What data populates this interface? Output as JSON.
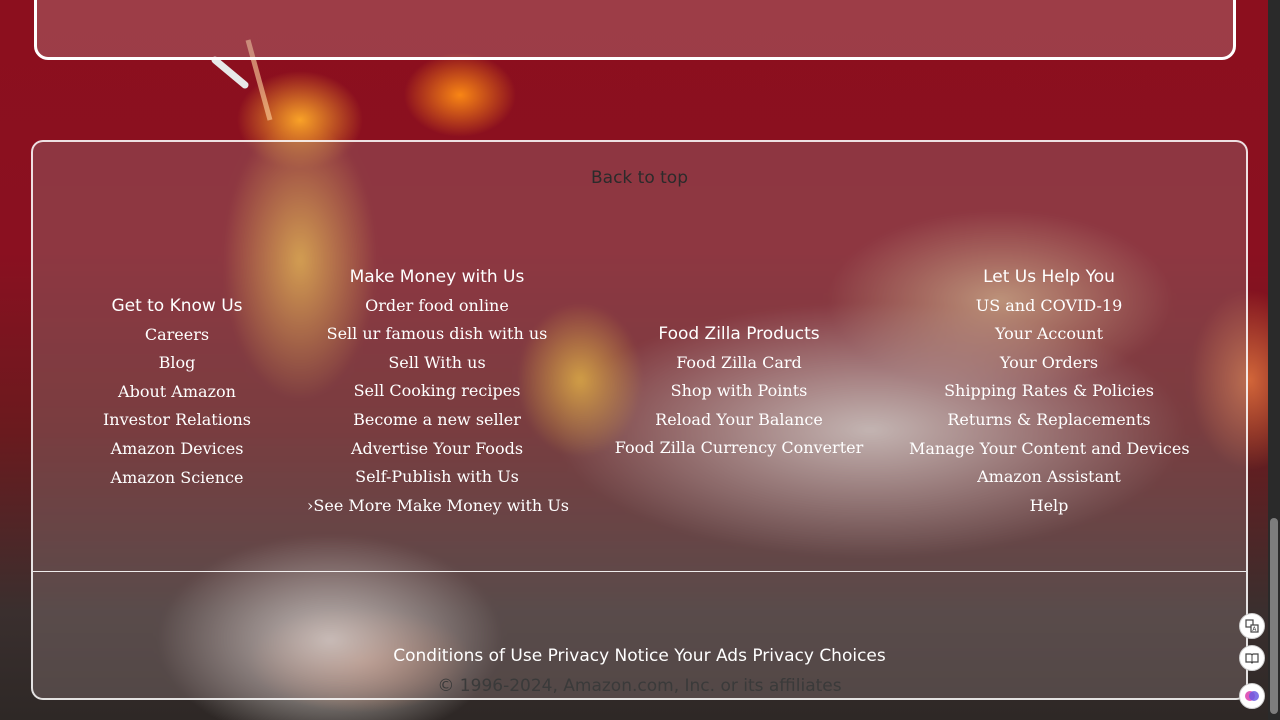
{
  "footer": {
    "back_to_top": "Back to top",
    "columns": [
      {
        "heading": "Get to Know Us",
        "links": [
          "Careers",
          "Blog",
          "About Amazon",
          "Investor Relations",
          "Amazon Devices",
          "Amazon Science"
        ]
      },
      {
        "heading": "Make Money with Us",
        "links": [
          "Order food online",
          "Sell ur famous dish with us",
          "Sell With us",
          "Sell Cooking recipes",
          "Become a new seller",
          "Advertise Your Foods",
          "Self-Publish with Us",
          "›See More Make Money with Us"
        ]
      },
      {
        "heading": "Food Zilla Products",
        "links": [
          "Food Zilla Card",
          "Shop with Points",
          "Reload Your Balance",
          "Food Zilla Currency Converter"
        ]
      },
      {
        "heading": "Let Us Help You",
        "links": [
          "US and COVID-19",
          "Your Account",
          "Your Orders",
          "Shipping Rates & Policies",
          "Returns & Replacements",
          "Manage Your Content and Devices",
          "Amazon Assistant",
          "Help"
        ]
      }
    ],
    "bottom_links": [
      "Conditions of Use",
      "Privacy Notice",
      "Your Ads Privacy Choices"
    ],
    "copyright": "© 1996-2024, Amazon.com, Inc. or its affiliates"
  },
  "side_buttons": {
    "translate_icon": "translate-icon",
    "reader_icon": "reader-icon",
    "assistant_icon": "assistant-icon"
  }
}
